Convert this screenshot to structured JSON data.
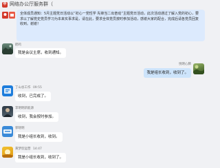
{
  "header": {
    "logo_glyph": "中",
    "title": "网络办公厅服务群（"
  },
  "announcement": {
    "text": "全体成员通知：5月主题党日活动以“初心一党性学 先锋当二出奋动”主题党日活动，此次活动通过了解入党的初心，要求以了解党史党员学习为本来实事求是，请在此，要求全体党员按时参加活动，感谢大家的配合，完成后请各党员回复收到。谢谢！"
  },
  "messages": [
    {
      "sender": "鹤鸣",
      "time": "",
      "text": "我是会议主席，收到通知。",
      "self": false
    },
    {
      "sender": "悦明心肺",
      "time": "",
      "text": "我是组长收到，收到了。",
      "self": true
    },
    {
      "sender": "丁山谷工作",
      "time": "09:55",
      "text": "收到，已完成了。",
      "self": false
    },
    {
      "sender": "李明明新能源",
      "time": "",
      "text": "收到，我会按时参加。",
      "self": false
    },
    {
      "sender": "郭晓明",
      "time": "",
      "text": "我是小组长收到，收到。",
      "self": false
    },
    {
      "sender": "黄梦欣运营",
      "time": "14:47",
      "text": "我是小组长收到，收到了。",
      "self": false
    }
  ],
  "colors": {
    "background": "#f0f1f4",
    "announcement_bubble": "#dceafd",
    "self_bubble": "#cde4fb",
    "other_bubble": "#ffffff",
    "brand_red": "#d33a2c"
  }
}
